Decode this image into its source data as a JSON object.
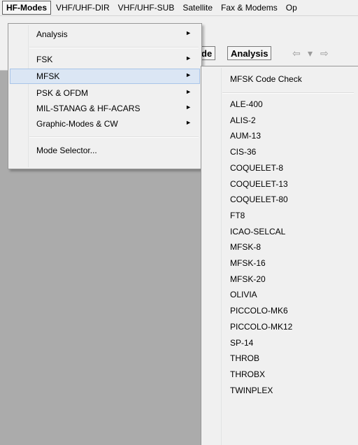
{
  "menubar": {
    "items": [
      "HF-Modes",
      "VHF/UHF-DIR",
      "VHF/UHF-SUB",
      "Satellite",
      "Fax & Modems",
      "Op"
    ]
  },
  "toolbar": {
    "partial_button": "de",
    "analysis_button": "Analysis",
    "back_glyph": "⇦",
    "dropdown_glyph": "▾",
    "forward_glyph": "⇨"
  },
  "hf_modes_menu": {
    "items": [
      {
        "label": "Analysis",
        "submenu_arrow": "►"
      },
      {
        "label": "FSK",
        "submenu_arrow": "►"
      },
      {
        "label": "MFSK",
        "submenu_arrow": "►"
      },
      {
        "label": "PSK & OFDM",
        "submenu_arrow": "►"
      },
      {
        "label": "MIL-STANAG & HF-ACARS",
        "submenu_arrow": "►"
      },
      {
        "label": "Graphic-Modes & CW",
        "submenu_arrow": "►"
      },
      {
        "label": "Mode Selector..."
      }
    ],
    "highlighted": "MFSK"
  },
  "mfsk_submenu": {
    "header_item": "MFSK Code Check",
    "items": [
      "ALE-400",
      "ALIS-2",
      "AUM-13",
      "CIS-36",
      "COQUELET-8",
      "COQUELET-13",
      "COQUELET-80",
      "FT8",
      "ICAO-SELCAL",
      "MFSK-8",
      "MFSK-16",
      "MFSK-20",
      "OLIVIA",
      "PICCOLO-MK6",
      "PICCOLO-MK12",
      "SP-14",
      "THROB",
      "THROBX",
      "TWINPLEX"
    ]
  },
  "colors": {
    "menu_bg": "#f0f0f0",
    "highlight_bg": "#dbe6f4",
    "highlight_border": "#a8c4e8",
    "workspace": "#ababab"
  }
}
